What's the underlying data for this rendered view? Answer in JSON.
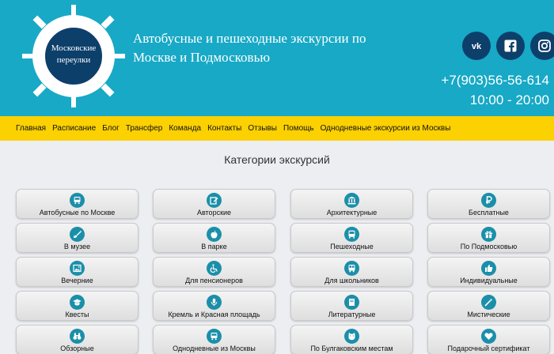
{
  "header": {
    "logo_text_line1": "Московские",
    "logo_text_line2": "переулки",
    "tagline_line1": "Автобусные и пешеходные экскурсии по",
    "tagline_line2": "Москве и Подмосковью",
    "phone": "+7(903)56-56-614",
    "hours": "10:00 - 20:00",
    "socials": [
      {
        "name": "vk-icon"
      },
      {
        "name": "facebook-icon"
      },
      {
        "name": "instagram-icon"
      }
    ]
  },
  "nav": {
    "items": [
      "Главная",
      "Расписание",
      "Блог",
      "Трансфер",
      "Команда",
      "Контакты",
      "Отзывы",
      "Помощь",
      "Однодневные экскурсии из Москвы"
    ]
  },
  "categories": {
    "title": "Категории экскурсий",
    "items": [
      {
        "label": "Автобусные по Москве",
        "icon": "bus-icon"
      },
      {
        "label": "Авторские",
        "icon": "edit-icon"
      },
      {
        "label": "Архитектурные",
        "icon": "building-icon"
      },
      {
        "label": "Бесплатные",
        "icon": "ruble-icon"
      },
      {
        "label": "В музее",
        "icon": "brush-icon"
      },
      {
        "label": "В парке",
        "icon": "apple-icon"
      },
      {
        "label": "Пешеходные",
        "icon": "bus-front-icon"
      },
      {
        "label": "По Подмосковью",
        "icon": "gift-icon"
      },
      {
        "label": "Вечерние",
        "icon": "picture-icon"
      },
      {
        "label": "Для пенсионеров",
        "icon": "wheelchair-icon"
      },
      {
        "label": "Для школьников",
        "icon": "school-bus-icon"
      },
      {
        "label": "Индивидуальные",
        "icon": "thumbs-up-icon"
      },
      {
        "label": "Квесты",
        "icon": "graduation-cap-icon"
      },
      {
        "label": "Кремль и Красная площадь",
        "icon": "microphone-icon"
      },
      {
        "label": "Литературные",
        "icon": "book-icon"
      },
      {
        "label": "Мистические",
        "icon": "magic-wand-icon"
      },
      {
        "label": "Обзорные",
        "icon": "binoculars-icon"
      },
      {
        "label": "Однодневные из Москвы",
        "icon": "bus-side-icon"
      },
      {
        "label": "По Булгаковским местам",
        "icon": "cat-icon"
      },
      {
        "label": "Подарочный сертификат",
        "icon": "heart-icon"
      }
    ]
  }
}
